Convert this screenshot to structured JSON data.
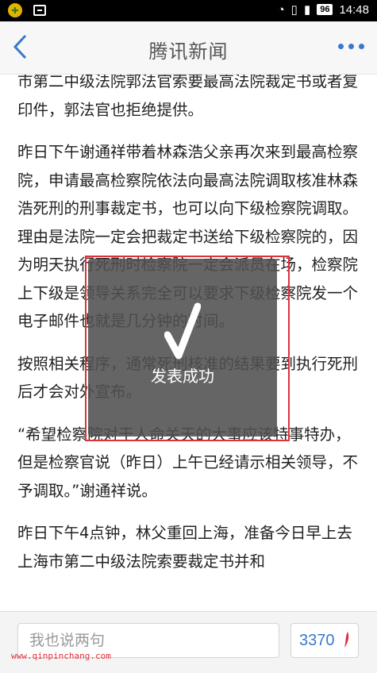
{
  "statusbar": {
    "battery": "96",
    "time": "14:48"
  },
  "navbar": {
    "title": "腾讯新闻"
  },
  "article": {
    "paragraphs": [
      "市第二中级法院郭法官索要最高法院裁定书或者复印件，郭法官也拒绝提供。",
      "昨日下午谢通祥带着林森浩父亲再次来到最高检察院，申请最高检察院依法向最高法院调取核准林森浩死刑的刑事裁定书，也可以向下级检察院调取。理由是法院一定会把裁定书送给下级检察院的，因为明天执行死刑时检察院一定会派员在场，检察院上下级是领导关系完全可以要求下级检察院发一个电子邮件也就是几分钟的时间。",
      "按照相关程序，通常死刑核准的结果要到执行死刑后才会对外宣布。",
      "“希望检察院对于人命关天的大事应该特事特办，但是检察官说（昨日）上午已经请示相关领导，不予调取。”谢通祥说。",
      "昨日下午4点钟，林父重回上海，准备今日早上去上海市第二中级法院索要裁定书并和"
    ]
  },
  "toast": {
    "message": "发表成功"
  },
  "bottom": {
    "comment_placeholder": "我也说两句",
    "comment_count": "3370",
    "watermark": "www.qinpinchang.com"
  }
}
